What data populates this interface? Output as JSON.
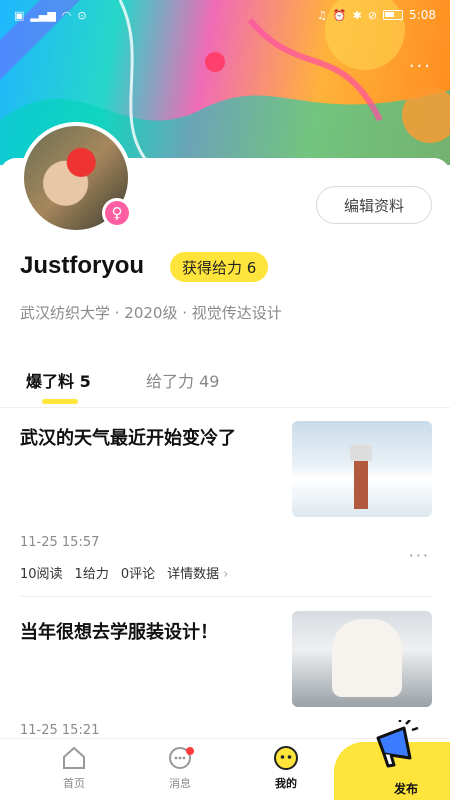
{
  "status_bar": {
    "time": "5:08"
  },
  "profile": {
    "username": "Justforyou",
    "gender_icon": "female-icon",
    "power_badge": "获得给力 6",
    "school": "武汉纺织大学 · 2020级 · 视觉传达设计",
    "edit_button": "编辑资料"
  },
  "tabs": [
    {
      "label": "爆了料",
      "count": "5",
      "active": true
    },
    {
      "label": "给了力",
      "count": "49",
      "active": false
    }
  ],
  "posts": [
    {
      "title": "武汉的天气最近开始变冷了",
      "time": "11-25 15:57",
      "reads": "10阅读",
      "power": "1给力",
      "comments": "0评论",
      "details": "详情数据"
    },
    {
      "title": "当年很想去学服装设计！",
      "time": "11-25 15:21"
    }
  ],
  "nav": {
    "home": "首页",
    "messages": "消息",
    "me": "我的",
    "publish": "发布"
  },
  "colors": {
    "accent_yellow": "#ffe53b",
    "female_pink": "#ff5fa2",
    "notification_red": "#ff3b3b"
  }
}
